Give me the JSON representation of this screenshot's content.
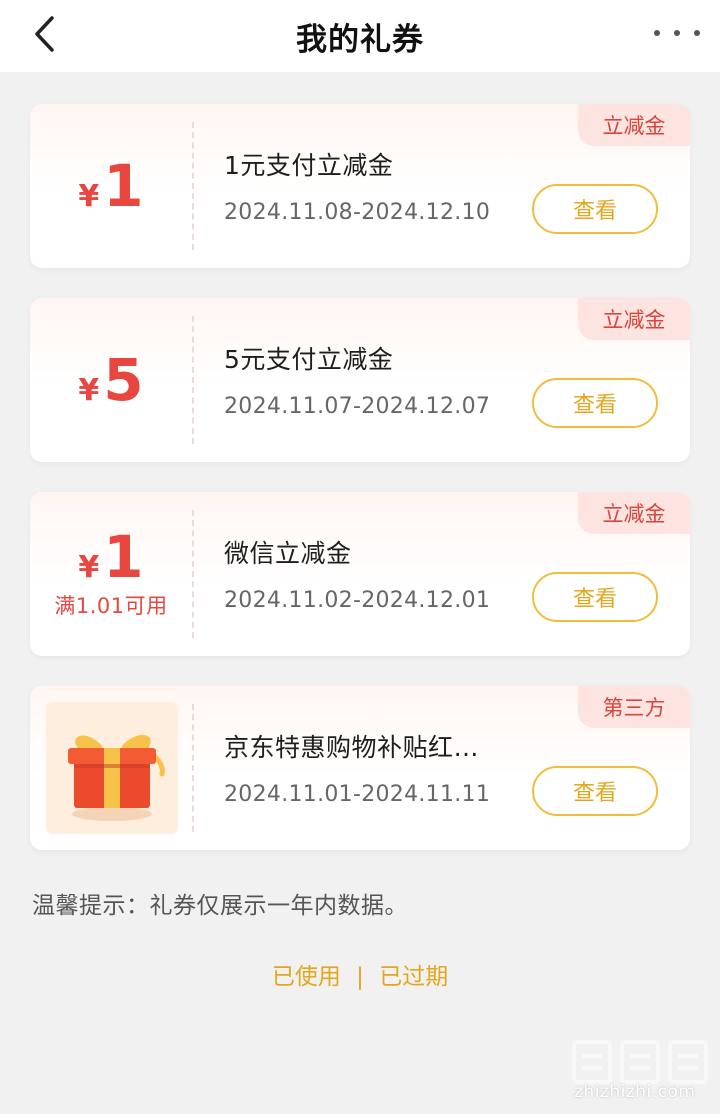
{
  "header": {
    "title": "我的礼券"
  },
  "coupons": [
    {
      "currency": "¥",
      "amount": "1",
      "condition": "",
      "title": "1元支付立减金",
      "date_range": "2024.11.08-2024.12.10",
      "tag": "立减金",
      "button_label": "查看"
    },
    {
      "currency": "¥",
      "amount": "5",
      "condition": "",
      "title": "5元支付立减金",
      "date_range": "2024.11.07-2024.12.07",
      "tag": "立减金",
      "button_label": "查看"
    },
    {
      "currency": "¥",
      "amount": "1",
      "condition": "满1.01可用",
      "title": "微信立减金",
      "date_range": "2024.11.02-2024.12.01",
      "tag": "立减金",
      "button_label": "查看"
    },
    {
      "image": "gift-box",
      "title": "京东特惠购物补贴红…",
      "date_range": "2024.11.01-2024.11.11",
      "tag": "第三方",
      "button_label": "查看"
    }
  ],
  "tip": "温馨提示：礼券仅展示一年内数据。",
  "bottom_links": {
    "used": "已使用",
    "separator": "|",
    "expired": "已过期"
  },
  "watermark": {
    "text": "zhizhizhi.com",
    "logo_text": "值值值"
  },
  "colors": {
    "accent_red": "#e8473f",
    "accent_gold": "#e3a71e",
    "tag_bg": "#fde4e0",
    "page_bg": "#f1f1f1"
  }
}
